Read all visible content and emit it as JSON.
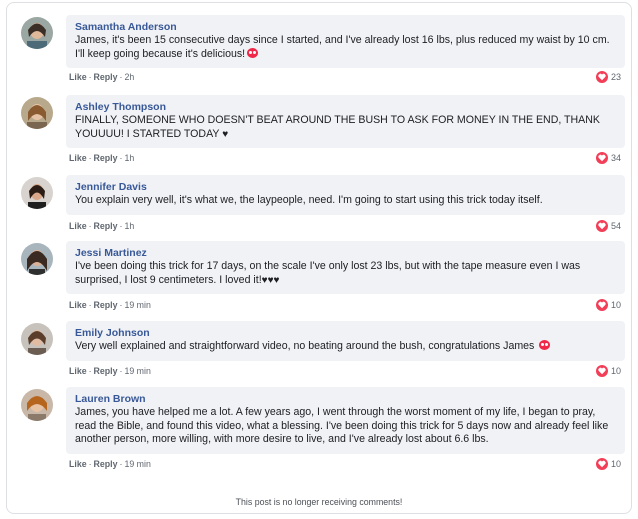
{
  "comments": [
    {
      "author": "Samantha Anderson",
      "text": "James, it's been 15 consecutive days since I started, and I've already lost 16 lbs, plus reduced my waist by 10 cm. I'll keep going because it's delicious!",
      "like": "Like",
      "reply": "Reply",
      "time": "2h",
      "reactions": "23"
    },
    {
      "author": "Ashley Thompson",
      "text": "FINALLY, SOMEONE WHO DOESN'T BEAT AROUND THE BUSH TO ASK FOR MONEY IN THE END, THANK YOUUUU! I STARTED TODAY",
      "like": "Like",
      "reply": "Reply",
      "time": "1h",
      "reactions": "34"
    },
    {
      "author": "Jennifer Davis",
      "text": "You explain very well, it's what we, the laypeople, need. I'm going to start using this trick today itself.",
      "like": "Like",
      "reply": "Reply",
      "time": "1h",
      "reactions": "54"
    },
    {
      "author": "Jessi Martinez",
      "text": "I've been doing this trick for 17 days, on the scale I've only lost 23 lbs, but with the tape measure even I was surprised, I lost 9 centimeters. I loved it!",
      "like": "Like",
      "reply": "Reply",
      "time": "19 min",
      "reactions": "10"
    },
    {
      "author": "Emily Johnson",
      "text": "Very well explained and straightforward video, no beating around the bush, congratulations James",
      "like": "Like",
      "reply": "Reply",
      "time": "19 min",
      "reactions": "10"
    },
    {
      "author": "Lauren Brown",
      "text": "James, you have helped me a lot. A few years ago, I went through the worst moment of my life, I began to pray, read the Bible, and found this video, what a blessing. I've been doing this trick for 5 days now and already feel like another person, more willing, with more desire to live, and I've already lost about 6.6 lbs.",
      "like": "Like",
      "reply": "Reply",
      "time": "19 min",
      "reactions": "10"
    }
  ],
  "emoji": {
    "black_heart": "♥",
    "black_hearts_triple": "♥♥♥"
  },
  "footer": "This post is no longer receiving comments!",
  "colors": {
    "author": "#385898",
    "bubble": "#f0f2f5",
    "heart": "#f33e58"
  }
}
